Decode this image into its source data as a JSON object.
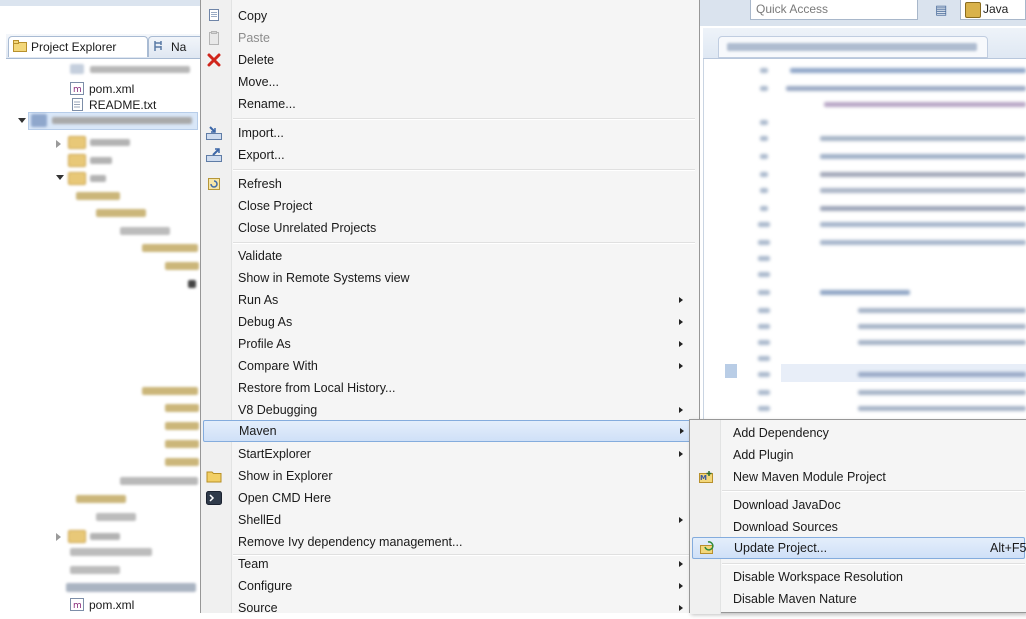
{
  "left_panel": {
    "tabs": [
      {
        "label": "Project Explorer",
        "icon": "project-explorer-icon"
      },
      {
        "label": "Na",
        "icon": "navigator-icon"
      }
    ],
    "tree": [
      {
        "label": "pom.xml",
        "icon": "maven-file-icon"
      },
      {
        "label": "README.txt",
        "icon": "text-file-icon"
      },
      {
        "label": "pom.xml",
        "icon": "maven-file-icon"
      }
    ]
  },
  "toolbar": {
    "quick_access_placeholder": "Quick Access",
    "perspective_label": "Java"
  },
  "context_menu": {
    "items": [
      {
        "label": "Copy",
        "icon": "copy-icon",
        "submenu": false,
        "enabled": true
      },
      {
        "label": "Paste",
        "icon": "paste-icon",
        "submenu": false,
        "enabled": false
      },
      {
        "label": "Delete",
        "icon": "delete-icon",
        "submenu": false,
        "enabled": true
      },
      {
        "label": "Move...",
        "submenu": false,
        "enabled": true
      },
      {
        "label": "Rename...",
        "submenu": false,
        "enabled": true
      },
      {
        "label": "Import...",
        "icon": "import-icon",
        "submenu": false,
        "enabled": true
      },
      {
        "label": "Export...",
        "icon": "export-icon",
        "submenu": false,
        "enabled": true
      },
      {
        "label": "Refresh",
        "icon": "refresh-icon",
        "submenu": false,
        "enabled": true
      },
      {
        "label": "Close Project",
        "submenu": false,
        "enabled": true
      },
      {
        "label": "Close Unrelated Projects",
        "submenu": false,
        "enabled": true
      },
      {
        "label": "Validate",
        "submenu": false,
        "enabled": true
      },
      {
        "label": "Show in Remote Systems view",
        "submenu": false,
        "enabled": true
      },
      {
        "label": "Run As",
        "submenu": true,
        "enabled": true
      },
      {
        "label": "Debug As",
        "submenu": true,
        "enabled": true
      },
      {
        "label": "Profile As",
        "submenu": true,
        "enabled": true
      },
      {
        "label": "Compare With",
        "submenu": true,
        "enabled": true
      },
      {
        "label": "Restore from Local History...",
        "submenu": false,
        "enabled": true
      },
      {
        "label": "V8 Debugging",
        "submenu": true,
        "enabled": true
      },
      {
        "label": "Maven",
        "submenu": true,
        "enabled": true,
        "highlighted": true
      },
      {
        "label": "StartExplorer",
        "submenu": true,
        "enabled": true
      },
      {
        "label": "Show in Explorer",
        "icon": "folder-icon",
        "submenu": false,
        "enabled": true
      },
      {
        "label": "Open CMD Here",
        "icon": "console-icon",
        "submenu": false,
        "enabled": true
      },
      {
        "label": "ShellEd",
        "submenu": true,
        "enabled": true
      },
      {
        "label": "Remove Ivy dependency management...",
        "submenu": false,
        "enabled": true
      },
      {
        "label": "Team",
        "submenu": true,
        "enabled": true
      },
      {
        "label": "Configure",
        "submenu": true,
        "enabled": true
      },
      {
        "label": "Source",
        "submenu": true,
        "enabled": true
      }
    ]
  },
  "maven_submenu": {
    "items": [
      {
        "label": "Add Dependency"
      },
      {
        "label": "Add Plugin"
      },
      {
        "label": "New Maven Module Project",
        "icon": "maven-module-icon"
      },
      {
        "label": "Download JavaDoc"
      },
      {
        "label": "Download Sources"
      },
      {
        "label": "Update Project...",
        "icon": "update-project-icon",
        "accelerator": "Alt+F5",
        "highlighted": true
      },
      {
        "label": "Disable Workspace Resolution"
      },
      {
        "label": "Disable Maven Nature"
      }
    ]
  },
  "colors": {
    "highlight_fill": "#cfe0f7",
    "highlight_border": "#84acdd",
    "menu_bg": "#f5f5f5",
    "disabled_text": "#8d8d8d"
  }
}
